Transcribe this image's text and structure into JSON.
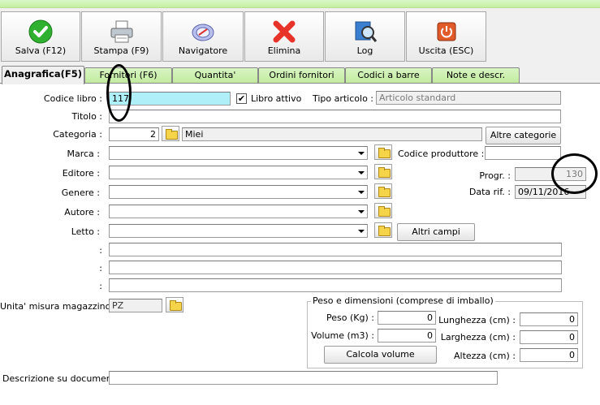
{
  "toolbar": {
    "save": "Salva (F12)",
    "print": "Stampa (F9)",
    "navigator": "Navigatore",
    "delete": "Elimina",
    "log": "Log",
    "exit": "Uscita (ESC)"
  },
  "tabs": [
    "Anagrafica(F5)",
    "Fornitori (F6)",
    "Quantita'",
    "Ordini fornitori",
    "Codici a barre",
    "Note e descr."
  ],
  "form": {
    "codice_libro_label": "Codice libro :",
    "codice_libro_value": "117",
    "libro_attivo_label": "Libro attivo",
    "libro_attivo_checked": "✔",
    "tipo_articolo_label": "Tipo articolo :",
    "tipo_articolo_value": "Articolo standard",
    "titolo_label": "Titolo :",
    "titolo_value": "",
    "categoria_label": "Categoria :",
    "categoria_code": "2",
    "categoria_name": "Miei",
    "altre_categorie": "Altre categorie",
    "marca_label": "Marca :",
    "editore_label": "Editore :",
    "genere_label": "Genere :",
    "autore_label": "Autore :",
    "letto_label": "Letto :",
    "altri_campi": "Altri campi",
    "codice_produttore_label": "Codice produttore :",
    "codice_produttore_value": "",
    "progr_label": "Progr. :",
    "progr_value": "130",
    "data_rif_label": "Data rif. :",
    "data_rif_value": "09/11/2016",
    "extra_label_1": ":",
    "extra_label_2": ":",
    "extra_label_3": ":",
    "unita_label": "Unita' misura magazzino :",
    "unita_value": "PZ",
    "descrizione_label": "Descrizione su documenti:",
    "descrizione_value": ""
  },
  "dimensions": {
    "title": "Peso e dimensioni (comprese di imballo)",
    "peso_label": "Peso (Kg) :",
    "peso_value": "0",
    "volume_label": "Volume (m3) :",
    "volume_value": "0",
    "lunghezza_label": "Lunghezza (cm) :",
    "lunghezza_value": "0",
    "larghezza_label": "Larghezza (cm) :",
    "larghezza_value": "0",
    "altezza_label": "Altezza (cm) :",
    "altezza_value": "0",
    "calcola_volume": "Calcola volume"
  },
  "colors": {
    "tab_green": "#c6ef9f",
    "code_field_cyan": "#aeeff8",
    "delete_red": "#e8332a",
    "save_green": "#2fb12f"
  },
  "icons": [
    "check-icon",
    "printer-icon",
    "compass-icon",
    "x-icon",
    "magnifier-book-icon",
    "power-icon",
    "folder-icon",
    "chevron-down-icon"
  ]
}
